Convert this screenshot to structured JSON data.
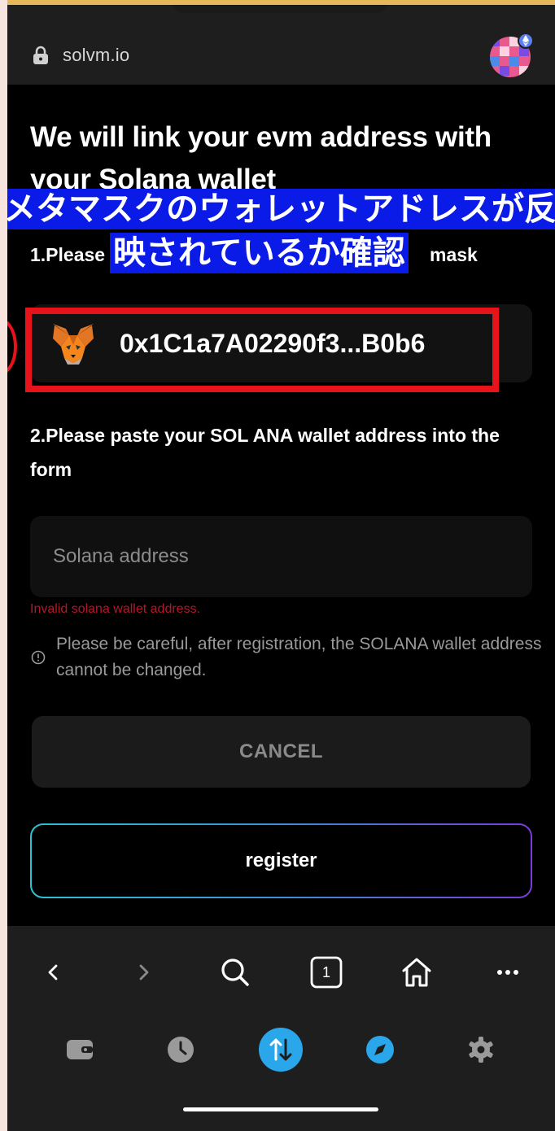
{
  "browser": {
    "url": "solvm.io"
  },
  "page": {
    "headline": "We will link your evm address with your Solana wallet",
    "step1_start": "1.Please",
    "step1_end": "mask",
    "evm_address": "0x1C1a7A02290f3...B0b6",
    "step2": "2.Please paste your SOL ANA wallet address into the form",
    "solana_placeholder": "Solana address",
    "solana_value": "",
    "error": "Invalid solana wallet address.",
    "warning": "Please be careful, after registration, the SOLANA wallet address cannot be changed.",
    "cancel_label": "CANCEL",
    "register_label": "register"
  },
  "caption": {
    "line1": "メタマスクのウォレットアドレスが反",
    "line2": "映されているか確認"
  },
  "toolbar": {
    "tab_count": "1"
  },
  "icons": {
    "lock": "lock-icon",
    "fox": "metamask-fox-icon",
    "info": "info-icon",
    "back": "chevron-left-icon",
    "forward": "chevron-right-icon",
    "search": "search-icon",
    "tabs": "tabs-icon",
    "home": "home-icon",
    "more": "more-icon",
    "wallet": "wallet-icon",
    "history": "clock-icon",
    "swap": "swap-icon",
    "discover": "compass-icon",
    "settings": "gear-icon"
  },
  "colors": {
    "accent_swap": "#2aa6ea",
    "error": "#b4172a",
    "highlight": "#e8131a",
    "caption_bg": "#0a1be8"
  }
}
